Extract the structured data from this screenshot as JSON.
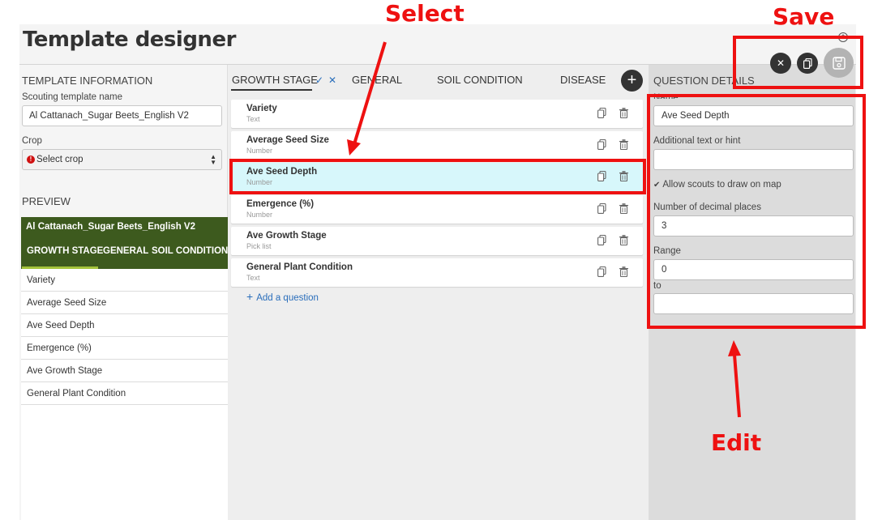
{
  "header": {
    "title": "Template designer"
  },
  "left": {
    "section_title": "TEMPLATE INFORMATION",
    "name_label": "Scouting template name",
    "name_value": "Al Cattanach_Sugar Beets_English V2",
    "crop_label": "Crop",
    "crop_value": "Select crop",
    "preview_title": "PREVIEW",
    "preview": {
      "template_name": "Al Cattanach_Sugar Beets_English V2",
      "tabs": [
        "GROWTH STAGE",
        "GENERAL",
        "SOIL CONDITION"
      ],
      "items": [
        "Variety",
        "Average Seed Size",
        "Ave Seed Depth",
        "Emergence (%)",
        "Ave Growth Stage",
        "General Plant Condition"
      ]
    }
  },
  "middle": {
    "tabs": [
      "GROWTH STAGE",
      "GENERAL",
      "SOIL CONDITION",
      "DISEASE"
    ],
    "add_tab_label": "+",
    "questions": [
      {
        "title": "Variety",
        "type": "Text"
      },
      {
        "title": "Average Seed Size",
        "type": "Number"
      },
      {
        "title": "Ave Seed Depth",
        "type": "Number"
      },
      {
        "title": "Emergence (%)",
        "type": "Number"
      },
      {
        "title": "Ave Growth Stage",
        "type": "Pick list"
      },
      {
        "title": "General Plant Condition",
        "type": "Text"
      }
    ],
    "selected_index": 2,
    "add_question": "Add a question"
  },
  "right": {
    "section_title": "QUESTION DETAILS",
    "name_label": "Name",
    "name_value": "Ave Seed Depth",
    "hint_label": "Additional text or hint",
    "hint_value": "",
    "draw_label": "Allow scouts to draw on map",
    "draw_checked": true,
    "decimals_label": "Number of decimal places",
    "decimals_value": "3",
    "range_label": "Range",
    "range_from": "0",
    "range_to_label": "to",
    "range_to": ""
  },
  "annotations": {
    "select": "Select",
    "save": "Save",
    "edit": "Edit"
  },
  "colors": {
    "accent_red": "#ee1111",
    "preview_green": "#3d5a1e",
    "selected_row": "#d7f7fb"
  }
}
